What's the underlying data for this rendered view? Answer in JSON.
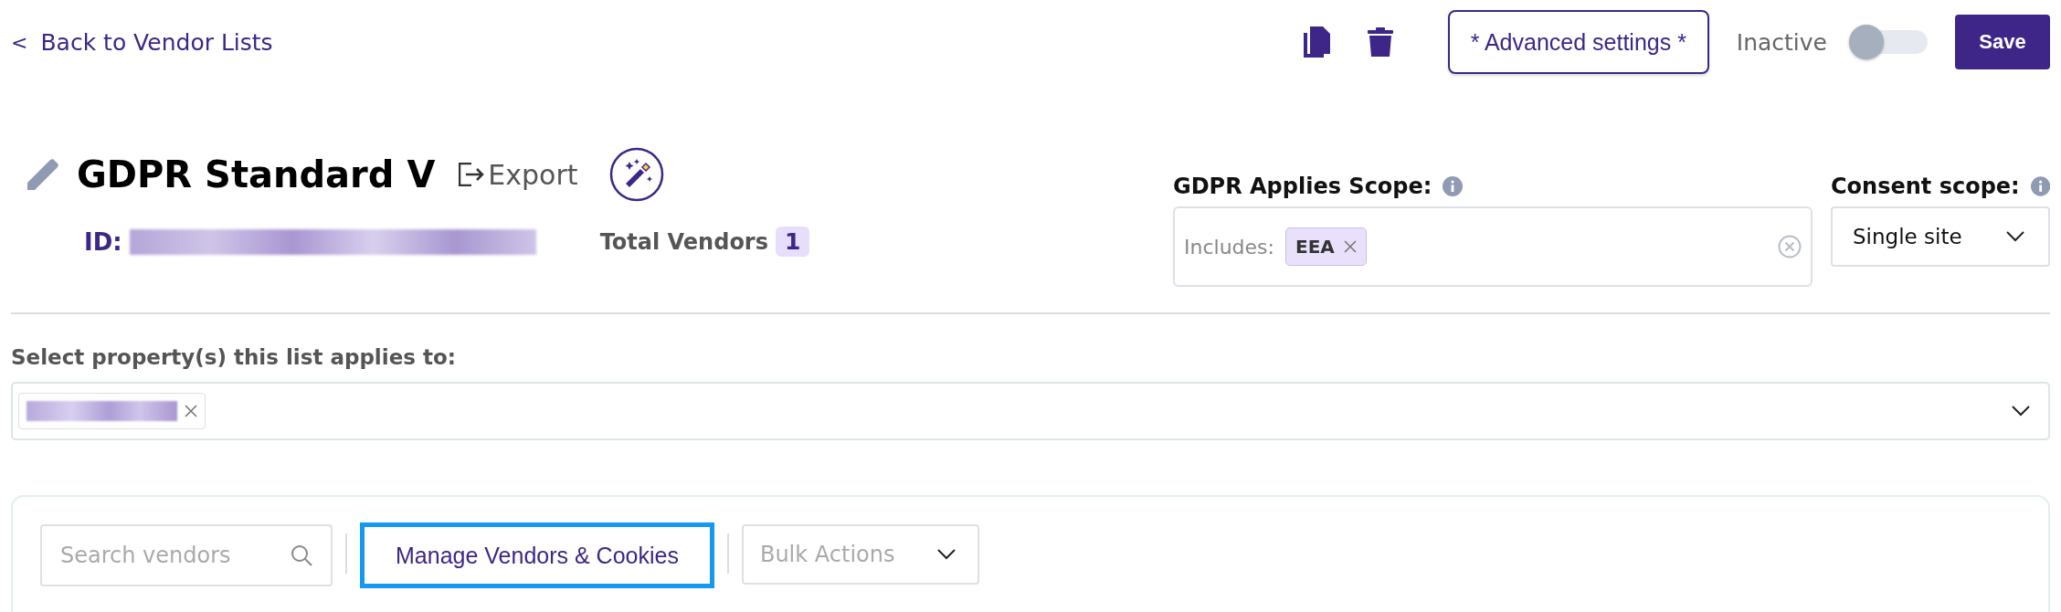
{
  "header": {
    "back_link": {
      "icon": "<",
      "label": "Back to Vendor Lists"
    },
    "advanced_button": "* Advanced settings *",
    "status": {
      "label": "Inactive",
      "on": false
    },
    "save_button": "Save"
  },
  "vendor_list": {
    "title": "GDPR Standard V",
    "export": "Export",
    "id_label": "ID:",
    "total_label": "Total Vendors",
    "total_count": "1"
  },
  "gdpr_scope": {
    "label": "GDPR Applies Scope:",
    "prefix": "Includes:",
    "chips": [
      "EEA"
    ]
  },
  "consent_scope": {
    "label": "Consent scope:",
    "value": "Single site"
  },
  "properties": {
    "label": "Select property(s) this list applies to:"
  },
  "toolbar": {
    "search": {
      "placeholder": "Search vendors"
    },
    "manage_button": {
      "label": "Manage Vendors & Cookies",
      "focused": true
    },
    "bulk_actions": {
      "placeholder": "Bulk Actions"
    }
  }
}
